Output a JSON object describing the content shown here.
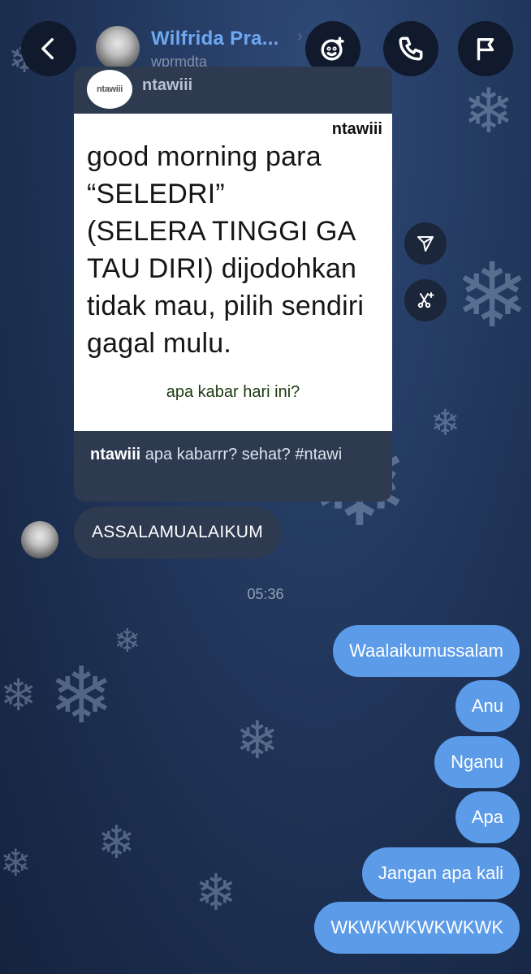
{
  "header": {
    "back_icon": "chevron-left-icon",
    "contact_name": "Wilfrida Pra...",
    "contact_handle": "wprmdta",
    "chevron": "›",
    "actions": [
      {
        "icon": "add-face-icon"
      },
      {
        "icon": "phone-icon"
      },
      {
        "icon": "flag-icon"
      }
    ]
  },
  "shared_post": {
    "avatar_text": "ntawiii",
    "username": "ntawiii",
    "image": {
      "watermark": "ntawiii",
      "lines": [
        "good morning para",
        "“SELEDRI”",
        "(SELERA TINGGI GA",
        "TAU DIRI) dijodohkan",
        "tidak mau, pilih sendiri",
        "gagal mulu."
      ],
      "subtext": "apa kabar hari ini?"
    },
    "caption_user": "ntawiii",
    "caption_text": " apa kabarrr? sehat? #ntawi",
    "side_actions": [
      {
        "icon": "share-icon"
      },
      {
        "icon": "remix-icon"
      }
    ]
  },
  "incoming_message": "ASSALAMUALAIKUM",
  "timestamp": "05:36",
  "outgoing_messages": [
    "Waalaikumussalam",
    "Anu",
    "Nganu",
    "Apa",
    "Jangan apa kali",
    "WKWKWKWKWKWK"
  ],
  "colors": {
    "outgoing_bubble": "#5c9be8",
    "incoming_bubble": "#2e3a50",
    "contact_name": "#6ea8f2"
  }
}
